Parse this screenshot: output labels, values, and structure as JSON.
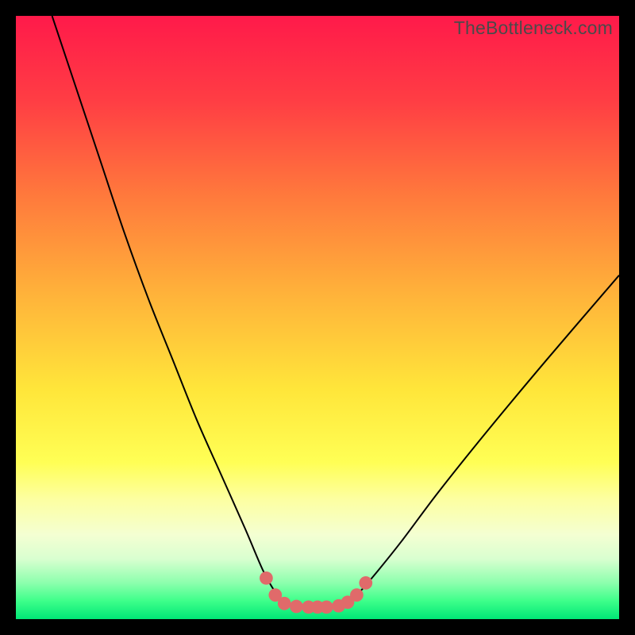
{
  "watermark": "TheBottleneck.com",
  "chart_data": {
    "type": "line",
    "title": "",
    "xlabel": "",
    "ylabel": "",
    "xlim": [
      0,
      100
    ],
    "ylim": [
      0,
      100
    ],
    "grid": false,
    "legend": false,
    "background_gradient": {
      "stops": [
        {
          "pct": 0,
          "color": "#ff1a4a"
        },
        {
          "pct": 14,
          "color": "#ff3d44"
        },
        {
          "pct": 30,
          "color": "#ff7a3c"
        },
        {
          "pct": 46,
          "color": "#ffb23a"
        },
        {
          "pct": 62,
          "color": "#ffe63a"
        },
        {
          "pct": 74,
          "color": "#ffff55"
        },
        {
          "pct": 80,
          "color": "#fdffa0"
        },
        {
          "pct": 86,
          "color": "#f4ffd2"
        },
        {
          "pct": 90,
          "color": "#d9ffd0"
        },
        {
          "pct": 94,
          "color": "#8cffad"
        },
        {
          "pct": 97,
          "color": "#3dff8a"
        },
        {
          "pct": 100,
          "color": "#00e676"
        }
      ]
    },
    "series": [
      {
        "name": "bottleneck-curve",
        "color": "#000000",
        "x": [
          6,
          10,
          14,
          18,
          22,
          26,
          30,
          34,
          38,
          41,
          43,
          44.5,
          46,
          48,
          50,
          52,
          54,
          55.5,
          57,
          60,
          64,
          70,
          78,
          88,
          100
        ],
        "y": [
          100,
          88,
          76,
          64,
          53,
          43,
          33,
          24,
          15,
          8,
          4.5,
          3,
          2.4,
          2.1,
          2.0,
          2.1,
          2.4,
          3,
          4.5,
          8,
          13,
          21,
          31,
          43,
          57
        ]
      },
      {
        "name": "highlight-dots",
        "color": "#e06a6a",
        "type": "scatter",
        "x": [
          41.5,
          43.0,
          44.5,
          46.5,
          48.5,
          50.0,
          51.5,
          53.5,
          55.0,
          56.5,
          58.0
        ],
        "y": [
          6.8,
          4.0,
          2.6,
          2.1,
          2.0,
          2.0,
          2.0,
          2.2,
          2.8,
          4.0,
          6.0
        ],
        "marker_radius": 1.1
      }
    ]
  }
}
